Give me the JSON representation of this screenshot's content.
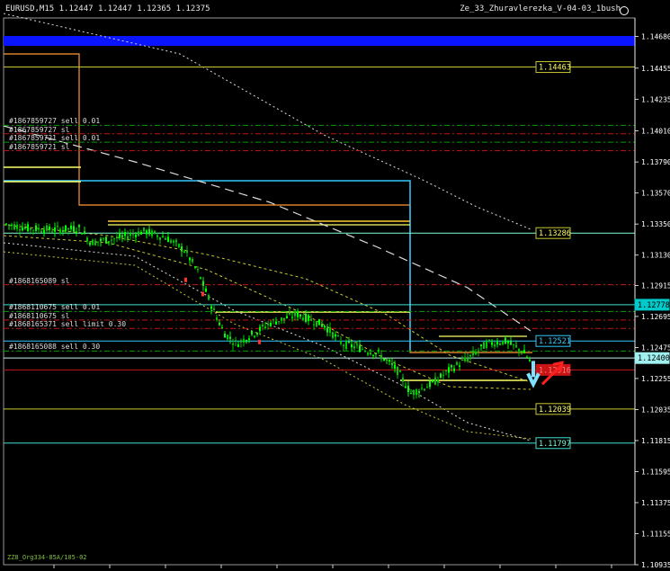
{
  "header": {
    "symbol_info": "EURUSD,M15  1.12447 1.12447 1.12365 1.12375",
    "ea_name": "Ze_33_Zhuravlerezka_V-04-03_1bush"
  },
  "price_axis": {
    "ticks": [
      "1.14680",
      "1.14455",
      "1.14235",
      "1.14010",
      "1.13790",
      "1.13570",
      "1.13350",
      "1.13130",
      "1.12915",
      "1.12695",
      "1.12475",
      "1.12255",
      "1.12035",
      "1.11815",
      "1.11595",
      "1.11375",
      "1.11155",
      "1.10935"
    ],
    "y_top_price": 1.149,
    "y_bottom_price": 1.10935
  },
  "price_tags": [
    {
      "value": "1.14463",
      "price": 1.14463,
      "bg": "#000000",
      "fg": "#ffff66",
      "border": "#c8c832",
      "line": "#c8c832"
    },
    {
      "value": "1.13286",
      "price": 1.13286,
      "bg": "#000000",
      "fg": "#ffff66",
      "border": "#c8c832",
      "line": "#7fffd4"
    },
    {
      "value": "1.12778",
      "price": 1.12778,
      "bg": "#00c9c9",
      "fg": "#000000",
      "border": "#00c9c9",
      "line": "#40e0d0"
    },
    {
      "value": "1.12521",
      "price": 1.12521,
      "bg": "#000000",
      "fg": "#33c8ff",
      "border": "#33c8ff",
      "line": "#33c8ff"
    },
    {
      "value": "1.12400",
      "price": 1.124,
      "bg": "#a0f0f0",
      "fg": "#000000",
      "border": "#a0f0f0",
      "line": "#c0f0f0"
    },
    {
      "value": "1.12316",
      "price": 1.12316,
      "bg": "#c81414",
      "fg": "#ff8080",
      "border": "#c81414",
      "line": "#c81414"
    },
    {
      "value": "1.12039",
      "price": 1.12039,
      "bg": "#000000",
      "fg": "#ffff66",
      "border": "#c8c832",
      "line": "#c8c832"
    },
    {
      "value": "1.11797",
      "price": 1.11797,
      "bg": "#000000",
      "fg": "#7fffd4",
      "border": "#40e0d0",
      "line": "#40e0d0"
    }
  ],
  "order_labels": [
    {
      "text": "#1867859727 sell 0.01",
      "price": 1.1405
    },
    {
      "text": "#1867859727 sl",
      "price": 1.1399
    },
    {
      "text": "#1867859721 sell 0.01",
      "price": 1.1393
    },
    {
      "text": "#1867859721 sl",
      "price": 1.1387
    },
    {
      "text": "#1868165089 sl",
      "price": 1.1292
    },
    {
      "text": "#1868110675 sell 0.01",
      "price": 1.1273
    },
    {
      "text": "#1868110675 sl",
      "price": 1.1267
    },
    {
      "text": "#1868165371 sell limit 0.30",
      "price": 1.1261
    },
    {
      "text": "#1868165088 sell 0.30",
      "price": 1.1245
    }
  ],
  "footer_label": "ZZ8_Org334-85A/105-02",
  "colors": {
    "background": "#000000",
    "bull_candle": "#00ff00",
    "ma_white": "#dcdcdc",
    "ma_yellow": "#c8c832",
    "channel_blue": "#33c8ff",
    "channel_orange": "#ff9933",
    "banner_blue": "#0a14ff",
    "sell_arrow": "#7fe0ff",
    "buy_arrow": "#ff2020"
  },
  "icons": {
    "smiley": "smiley-icon",
    "sell_arrow": "down-arrow-icon",
    "buy_arrow": "up-arrow-icon"
  }
}
